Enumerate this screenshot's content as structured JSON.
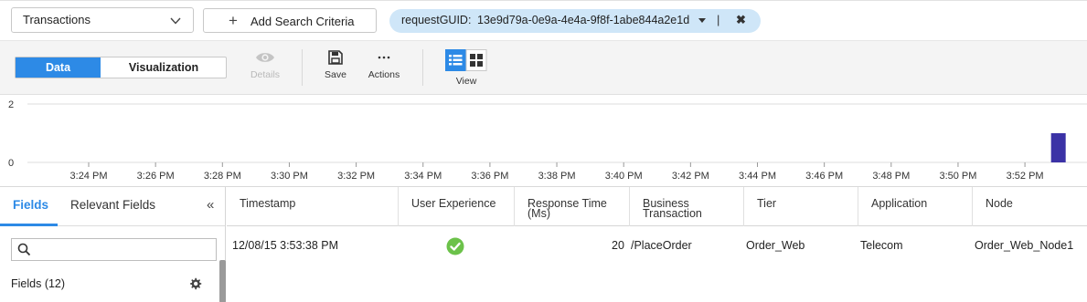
{
  "search": {
    "entity_select": "Transactions",
    "add_criteria_label": "Add Search Criteria",
    "chip": {
      "key": "requestGUID:",
      "value": "13e9d79a-0e9a-4e4a-9f8f-1abe844a2e1d",
      "separator": "|"
    }
  },
  "toolbar": {
    "view_toggle": {
      "data_label": "Data",
      "visualization_label": "Visualization",
      "active": "Data"
    },
    "details_label": "Details",
    "save_label": "Save",
    "actions_label": "Actions",
    "view_label": "View",
    "accent_color": "#2d8ae6"
  },
  "chart_data": {
    "type": "bar",
    "ylim": [
      0,
      2
    ],
    "y_ticks": [
      "0",
      "2"
    ],
    "x_ticks": [
      "3:24 PM",
      "3:26 PM",
      "3:28 PM",
      "3:30 PM",
      "3:32 PM",
      "3:34 PM",
      "3:36 PM",
      "3:38 PM",
      "3:40 PM",
      "3:42 PM",
      "3:44 PM",
      "3:46 PM",
      "3:48 PM",
      "3:50 PM",
      "3:52 PM"
    ],
    "series": [
      {
        "x": [
          "3:53 PM"
        ],
        "values": [
          1
        ]
      }
    ],
    "bar_color": "#3b32a6",
    "grid": true
  },
  "fields_panel": {
    "tabs": [
      "Fields",
      "Relevant Fields"
    ],
    "active_tab": "Fields",
    "collapse_icon": "double-chevron-left",
    "search_placeholder": "",
    "fields_count_label": "Fields (12)"
  },
  "table": {
    "columns": [
      "Timestamp",
      "User Experience",
      "Response Time (Ms)",
      "Business Transaction",
      "Tier",
      "Application",
      "Node"
    ],
    "rows": [
      {
        "timestamp": "12/08/15 3:53:38 PM",
        "user_experience": "normal",
        "response_time": "20",
        "business_transaction": "/PlaceOrder",
        "tier": "Order_Web",
        "application": "Telecom",
        "node": "Order_Web_Node1"
      }
    ],
    "ok_color": "#6cc24a"
  }
}
